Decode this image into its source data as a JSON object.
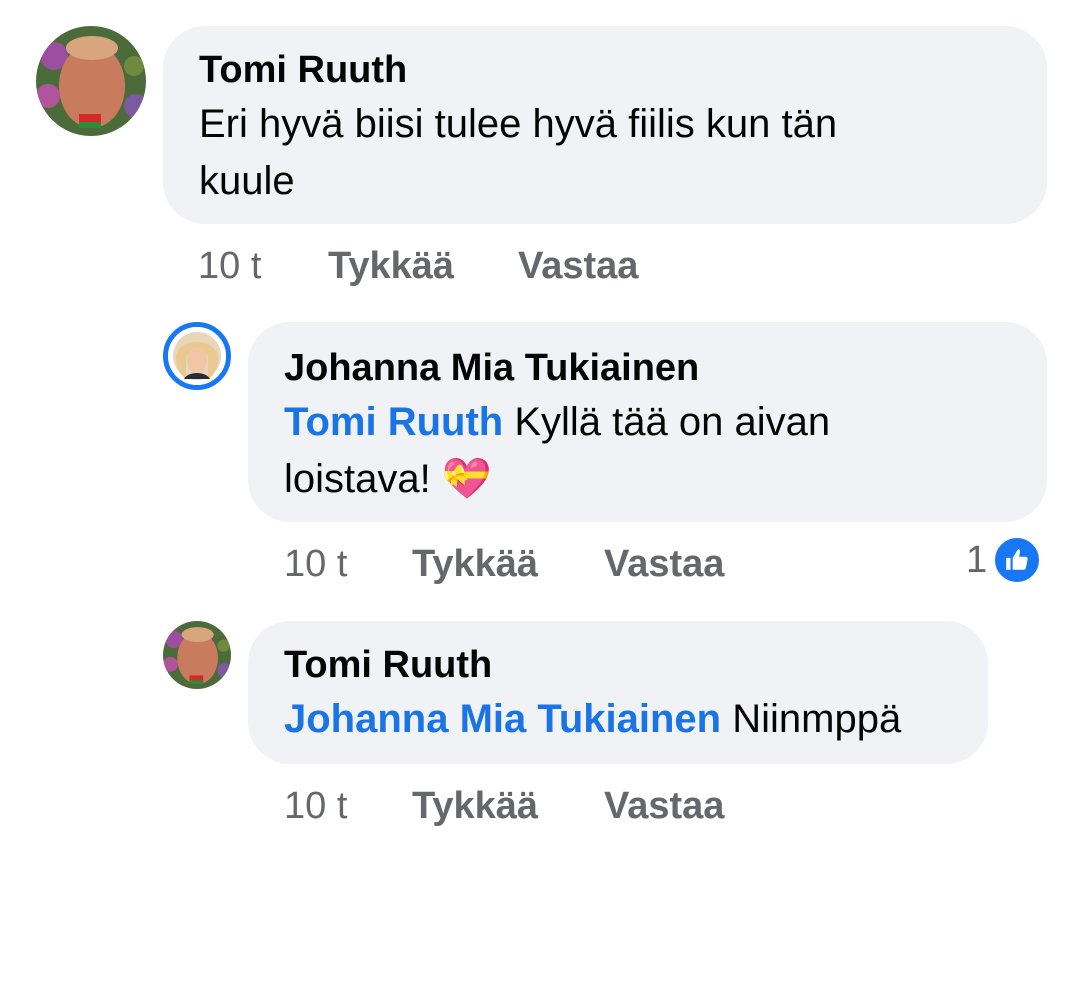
{
  "comments": [
    {
      "author": "Tomi Ruuth",
      "mention": "",
      "text_line1": "Eri hyvä biisi tulee hyvä fiilis kun tän",
      "text_line2": "kuule",
      "time": "10 t",
      "like_label": "Tykkää",
      "reply_label": "Vastaa"
    },
    {
      "author": "Johanna Mia Tukiainen",
      "mention": "Tomi Ruuth",
      "text_line1": "Kyllä tää on aivan",
      "text_line2": "loistava!",
      "emoji": "💝",
      "time": "10 t",
      "like_label": "Tykkää",
      "reply_label": "Vastaa",
      "reaction_count": "1",
      "reaction_icon": "like-icon"
    },
    {
      "author": "Tomi Ruuth",
      "mention": "Johanna Mia Tukiainen",
      "text_line1": "Niinmppä",
      "time": "10 t",
      "like_label": "Tykkää",
      "reply_label": "Vastaa"
    }
  ],
  "colors": {
    "bubble": "#f0f2f5",
    "mention": "#1b74e4",
    "meta": "#65676b",
    "like_blue": "#1877f2",
    "story_ring": "#1877f2"
  }
}
